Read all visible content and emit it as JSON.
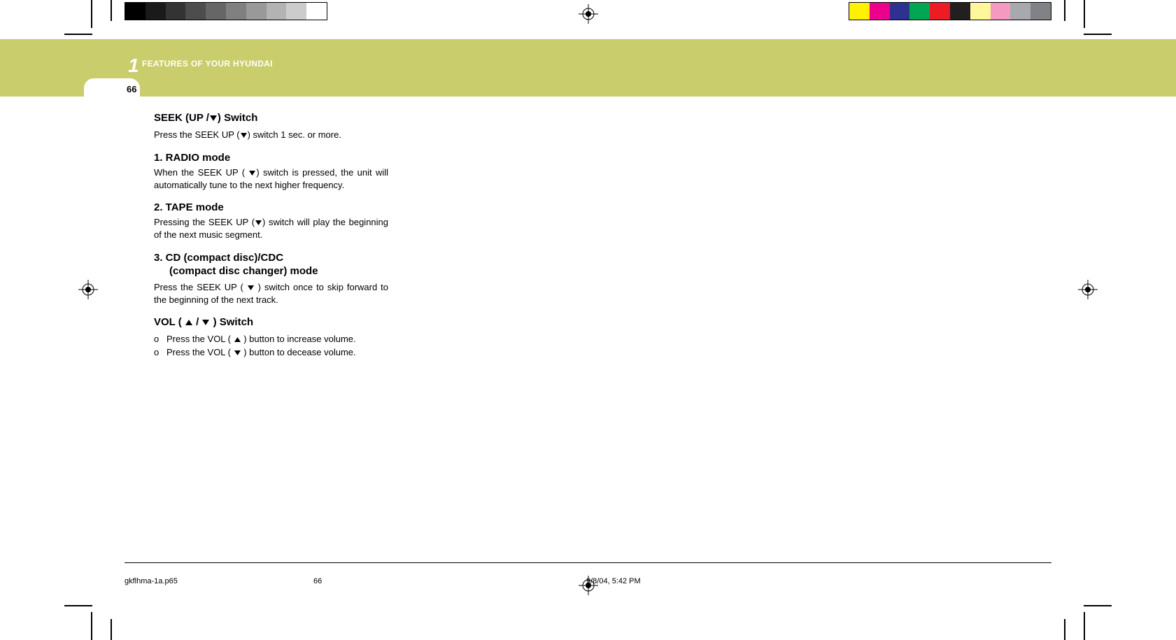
{
  "header": {
    "chapter_number": "1",
    "chapter_title": "FEATURES OF YOUR HYUNDAI",
    "page_number": "66"
  },
  "seek": {
    "heading_pre": "SEEK (UP /",
    "heading_post": ") Switch",
    "intro_pre": "Press the SEEK UP (",
    "intro_post": ") switch 1 sec. or more."
  },
  "radio": {
    "heading": "1.  RADIO mode",
    "body_pre": "When the SEEK UP ( ",
    "body_post": ") switch is pressed, the unit will automatically tune to the next higher frequency."
  },
  "tape": {
    "heading": "2.  TAPE mode",
    "body_pre": "Pressing the SEEK UP (",
    "body_post": ") switch  will play the beginning of the next music segment."
  },
  "cd": {
    "heading_line1": "3.  CD (compact disc)/CDC",
    "heading_line2": "(compact disc changer) mode",
    "body_pre": "Press the SEEK UP ( ",
    "body_post": " ) switch once to skip forward to the beginning of the next track."
  },
  "vol": {
    "heading_pre": "VOL ( ",
    "heading_mid": " / ",
    "heading_post": " ) Switch",
    "item1_pre": "Press the VOL ( ",
    "item1_post": " ) button to increase volume.",
    "item2_pre": "Press the VOL ( ",
    "item2_post": " ) button to decease volume.",
    "bullet": "o"
  },
  "footer": {
    "filename": "gkflhma-1a.p65",
    "page": "66",
    "timestamp": "9/8/04, 5:42 PM"
  },
  "swatches": {
    "grays": [
      "#000000",
      "#1a1a1a",
      "#333333",
      "#4d4d4d",
      "#666666",
      "#808080",
      "#999999",
      "#b3b3b3",
      "#cccccc",
      "#ffffff"
    ],
    "colors": [
      "#fff200",
      "#ec008c",
      "#2e3192",
      "#00a651",
      "#ed1c24",
      "#231f20",
      "#fff799",
      "#f49ac1",
      "#a7a9ac",
      "#808285"
    ]
  }
}
